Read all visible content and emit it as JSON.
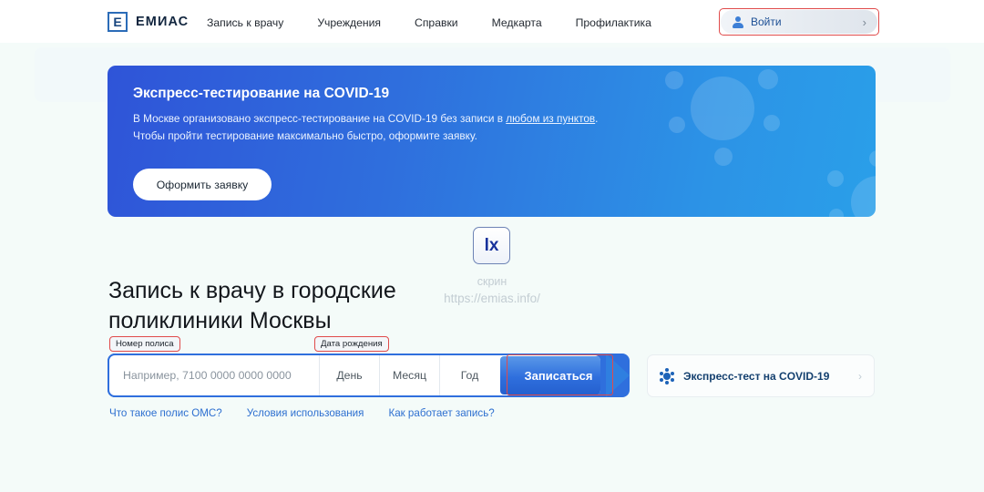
{
  "header": {
    "logo_letter": "Е",
    "logo_text": "ЕМИАС",
    "nav": [
      {
        "label": "Запись к врачу"
      },
      {
        "label": "Учреждения"
      },
      {
        "label": "Справки"
      },
      {
        "label": "Медкарта"
      },
      {
        "label": "Профилактика"
      }
    ],
    "login_label": "Войти",
    "login_chevron": "›"
  },
  "banner": {
    "title": "Экспресс-тестирование на COVID-19",
    "body_part1": "В Москве организовано экспресс-тестирование на COVID-19 без записи в ",
    "body_link": "любом из пунктов",
    "body_part2": ". Чтобы пройти тестирование максимально быстро, оформите заявку.",
    "button_label": "Оформить заявку"
  },
  "watermark": {
    "mark": "lx",
    "line1": "скрин",
    "line2": "https://emias.info/"
  },
  "hero": {
    "title": "Запись к врачу в городские поликлиники Москвы"
  },
  "form": {
    "annotations": {
      "policy": "Номер полиса",
      "birthdate": "Дата рождения"
    },
    "policy_placeholder": "Например, 7100 0000 0000 0000",
    "policy_value": "",
    "date_segments": [
      {
        "label": "День"
      },
      {
        "label": "Месяц"
      },
      {
        "label": "Год"
      }
    ],
    "submit_label": "Записаться"
  },
  "covid_card": {
    "label": "Экспресс-тест на COVID-19",
    "chevron": "›"
  },
  "footer_links": [
    {
      "label": "Что такое полис ОМС?"
    },
    {
      "label": "Условия использования"
    },
    {
      "label": "Как работает запись?"
    }
  ],
  "colors": {
    "brand_blue": "#2f6fdd",
    "banner_gradient_start": "#2f54d8",
    "banner_gradient_end": "#2a9fe9",
    "annotation_red": "#e04b4b",
    "page_background": "#f4fbf9",
    "link_blue": "#2d6fd0"
  }
}
